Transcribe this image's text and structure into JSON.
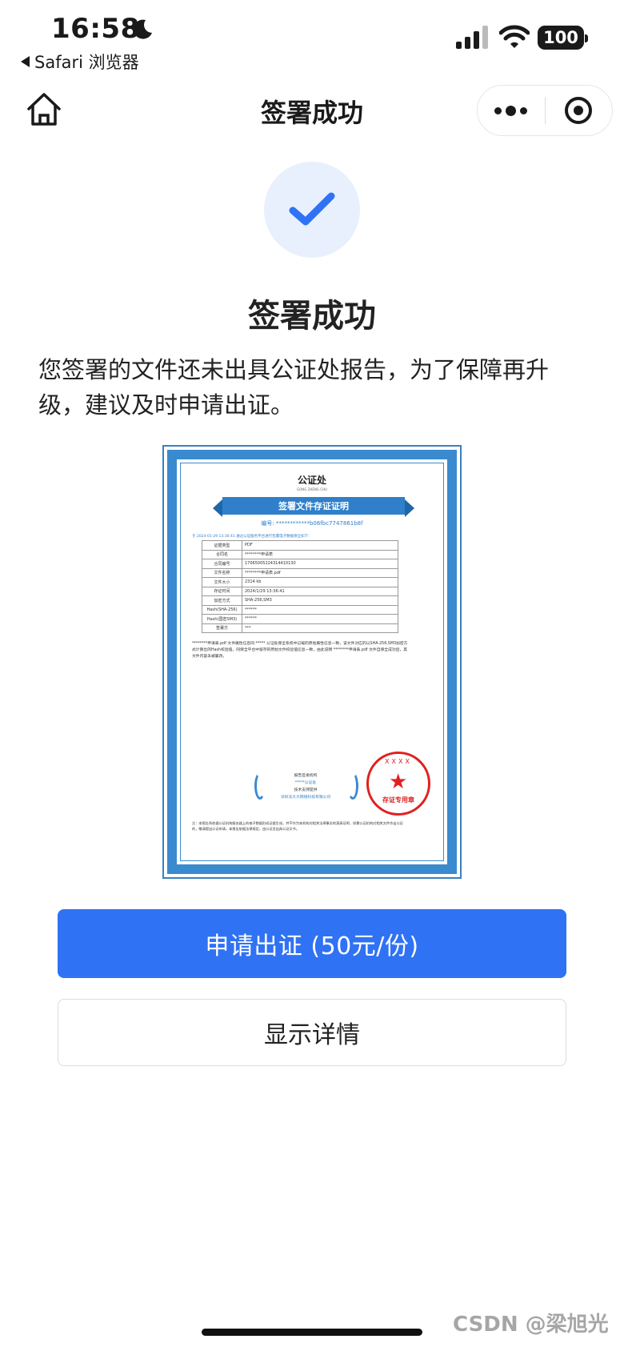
{
  "status_bar": {
    "time": "16:58",
    "back_app": "Safari 浏览器",
    "battery": "100"
  },
  "nav": {
    "title": "签署成功",
    "icons": [
      "home-icon",
      "more-icon",
      "close-capsule-icon"
    ]
  },
  "main": {
    "success_title": "签署成功",
    "notice": "您签署的文件还未出具公证处报告，为了保障再升级，建议及时申请出证。"
  },
  "certificate": {
    "header": "公证处",
    "pinyin": "GONG ZHENG CHU",
    "ribbon": "签署文件存证证明",
    "number": "编号: ************b06fbc7747861b8f",
    "intro": "于 2024-01-29 13:36:41 通过公证服务平台进行签署电子数据保全如下：",
    "rows": [
      {
        "label": "证据类型",
        "value": "PDF"
      },
      {
        "label": "合同名",
        "value": "********申请表"
      },
      {
        "label": "合同编号",
        "value": "17065005224314410130"
      },
      {
        "label": "文件名称",
        "value": "********申请表.pdf"
      },
      {
        "label": "文件大小",
        "value": "2314 kb"
      },
      {
        "label": "存证时间",
        "value": "2024/1/29 13:36:41"
      },
      {
        "label": "加密方式",
        "value": "SHA-256,SM3"
      },
      {
        "label": "Hash(SHA-256)",
        "value": "******"
      },
      {
        "label": "Hash(国密SM3)",
        "value": "******"
      },
      {
        "label": "签署方",
        "value": "***"
      }
    ],
    "body": "********申请表.pdf 文件属性信息同 ***** 公证处保全系统中记载的原始属性信息一致，该文件对应的以SHA-256,SM3加密方式计算出的Hash校验值，同保全平台中留存的原始文件校验值信息一致，由此说明 ********申请表.pdf 文件自保全成功后，其文件内容未被篡改。",
    "org_label": "报告签发机构",
    "org_name": "*****公证处",
    "tech_label": "技术支持提供",
    "tech_name": "深圳法大大网络科技有限公司",
    "seal_top": "XXXX",
    "seal_text": "存证专用章",
    "footer": "注：本报告系依据公证机构服务器上的电子数据形成证据生成，并不作为本机构对相关法律事实的直接证明，如需公证机构对相关文件作出公证的，敬请提出公证申请，本报告依据法律规定，由公证员出具公证文书。"
  },
  "actions": {
    "apply_label": "申请出证 (50元/份)",
    "details_label": "显示详情"
  },
  "watermark": "CSDN @梁旭光",
  "colors": {
    "primary": "#2f72f4",
    "success_bg": "#e8f0fd",
    "cert_border": "#3a8ad0",
    "seal": "#e02020"
  }
}
